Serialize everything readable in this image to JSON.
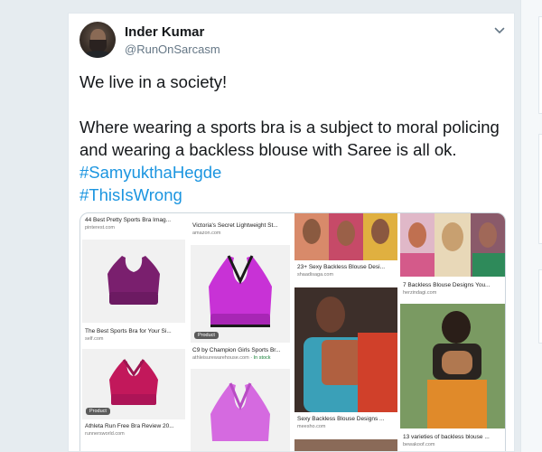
{
  "tweet": {
    "display_name": "Inder Kumar",
    "handle": "@RunOnSarcasm",
    "line1": "We live in a society!",
    "body": "Where wearing a sports bra is a subject to moral policing and wearing a backless blouse with Saree is all ok. ",
    "hashtag1": "#SamyukthaHegde",
    "hashtag2": "#ThisIsWrong"
  },
  "media": {
    "col1": {
      "t1_title": "44 Best Pretty Sports Bra Imag...",
      "t1_src": "pinterest.com",
      "t2_title": "The Best Sports Bra for Your Si...",
      "t2_src": "self.com",
      "badge": "Product",
      "t3_title": "Athleta Run Free Bra Review 20...",
      "t3_src": "runnersworld.com"
    },
    "col2": {
      "t1_title": "Victoria's Secret Lightweight St...",
      "t1_src": "amazon.com",
      "badge": "Product",
      "t2_title": "C9 by Champion Girls Sports Br...",
      "t2_src": "athleisurewarehouse.com",
      "t2_stock": "· In stock"
    },
    "col3": {
      "t1_title": "23+ Sexy Backless Blouse Desi...",
      "t1_src": "shaadisaga.com",
      "t2_title": "Sexy Backless Blouse Designs ...",
      "t2_src": "meesho.com"
    },
    "col4": {
      "t1_title": "7 Backless Blouse Designs You...",
      "t1_src": "herzindagi.com",
      "t2_title": "13 varieties of backless blouse ...",
      "t2_src": "bewakoof.com"
    }
  },
  "colors": {
    "hashtag": "#1b95e0",
    "text": "#14171a",
    "muted": "#657786"
  },
  "icons": {
    "chevron": "chevron-down-icon"
  }
}
